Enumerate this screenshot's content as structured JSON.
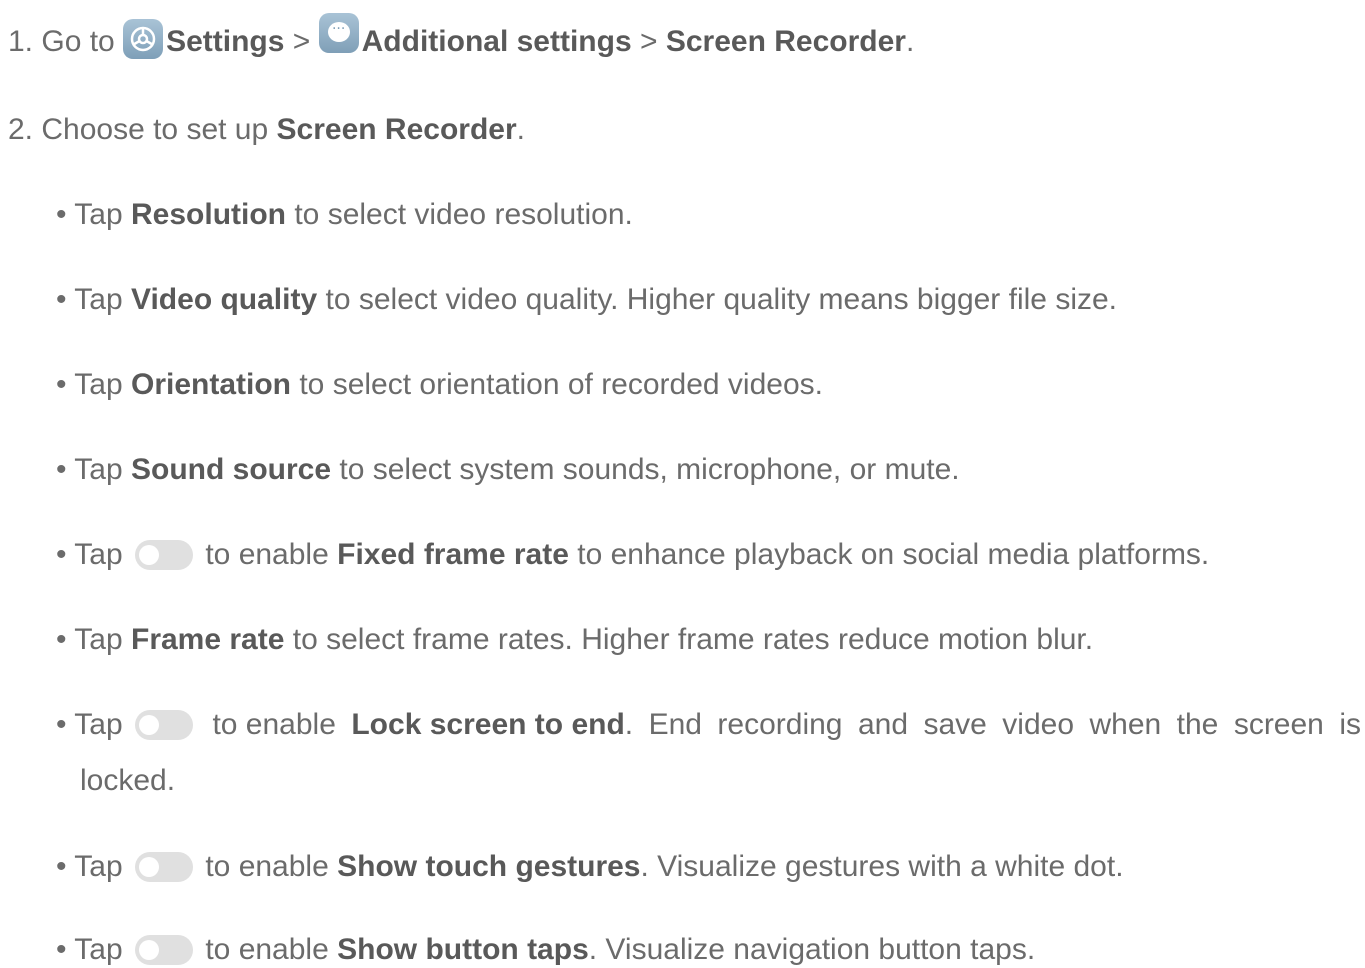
{
  "step1": {
    "prefix": "1. Go to ",
    "settings": "Settings",
    "sep1": " > ",
    "additional": "Additional settings",
    "sep2": " > ",
    "recorder": "Screen Recorder",
    "end": "."
  },
  "step2": {
    "prefix": "2. Choose to set up ",
    "recorder": "Screen Recorder",
    "end": "."
  },
  "bullets": [
    {
      "pre": "• Tap ",
      "bold": "Resolution",
      "post": " to select video resolution."
    },
    {
      "pre": "• Tap ",
      "bold": "Video quality",
      "post": " to select video quality. Higher quality means bigger file size."
    },
    {
      "pre": "• Tap ",
      "bold": "Orientation",
      "post": " to select orientation of recorded videos."
    },
    {
      "pre": "• Tap ",
      "bold": "Sound source",
      "post": " to select system sounds, microphone, or mute."
    },
    {
      "pre": "• Tap ",
      "mid": " to enable ",
      "bold": "Fixed frame rate",
      "post": " to enhance playback on social media platforms.",
      "toggle_on": false
    },
    {
      "pre": "• Tap ",
      "bold": "Frame rate",
      "post": " to select frame rates. Higher frame rates reduce motion blur."
    },
    {
      "pre": "• Tap ",
      "mid": " to enable ",
      "bold": "Lock screen to end",
      "post_words": [
        ".",
        "End",
        "recording",
        "and",
        "save",
        "video",
        "when",
        "the",
        "screen",
        "is"
      ],
      "post2": "locked.",
      "toggle_on": false
    },
    {
      "pre": "• Tap ",
      "mid": " to enable ",
      "bold": "Show touch gestures",
      "post": ". Visualize gestures with a white dot.",
      "toggle_on": false
    },
    {
      "pre": "• Tap ",
      "mid": " to enable ",
      "bold": "Show button taps",
      "post": ". Visualize navigation button taps.",
      "toggle_on": false
    }
  ],
  "icons": {
    "settings": "gear-icon",
    "additional": "more-dots-icon",
    "toggle": "toggle-switch-icon"
  },
  "colors": {
    "text": "#6b6b6b",
    "bold": "#595959",
    "icon": "#8fb0c8",
    "toggle_off": "#e0e0e0"
  }
}
